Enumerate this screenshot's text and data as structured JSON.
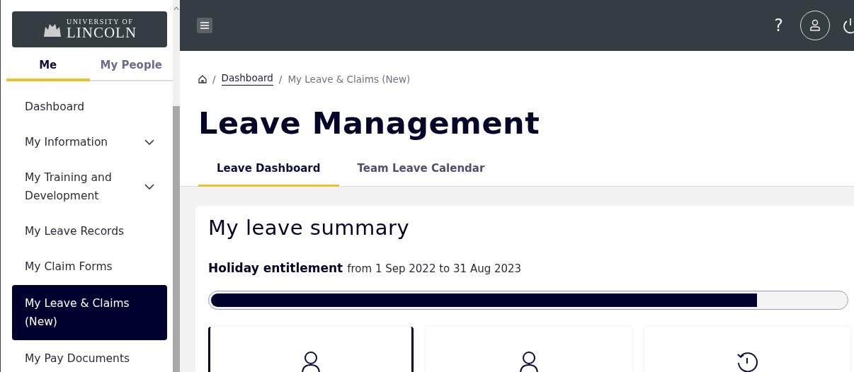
{
  "logo": {
    "line_1": "UNIVERSITY OF",
    "line_2": "LINCOLN"
  },
  "sidebar": {
    "tabs": [
      {
        "label": "Me",
        "selected": true
      },
      {
        "label": "My People",
        "selected": false
      }
    ],
    "items": [
      {
        "label": "Dashboard",
        "expandable": false,
        "selected": false
      },
      {
        "label": "My Information",
        "expandable": true,
        "selected": false
      },
      {
        "label": "My Training and Development",
        "expandable": true,
        "selected": false
      },
      {
        "label": "My Leave Records",
        "expandable": false,
        "selected": false
      },
      {
        "label": "My Claim Forms",
        "expandable": false,
        "selected": false
      },
      {
        "label": "My Leave & Claims (New)",
        "expandable": false,
        "selected": true
      },
      {
        "label": "My Pay Documents",
        "expandable": false,
        "selected": false
      }
    ]
  },
  "topbar": {
    "help": "?"
  },
  "breadcrumb": [
    {
      "kind": "home"
    },
    {
      "kind": "separator",
      "text": "/"
    },
    {
      "kind": "link",
      "text": "Dashboard"
    },
    {
      "kind": "separator",
      "text": "/"
    },
    {
      "kind": "current",
      "text": "My Leave & Claims (New)"
    }
  ],
  "title": "Leave Management",
  "tabs": [
    {
      "label": "Leave Dashboard",
      "selected": true
    },
    {
      "label": "Team Leave Calendar",
      "selected": false
    }
  ],
  "summary": {
    "heading": "My leave summary",
    "entitlement_label": "Holiday entitlement",
    "entitlement_period": "from 1 Sep 2022 to 31 Aug 2023",
    "level": 0.86,
    "cards": [
      {
        "kind": "person",
        "selected": true
      },
      {
        "kind": "person",
        "selected": false
      },
      {
        "kind": "history",
        "selected": false
      }
    ]
  }
}
